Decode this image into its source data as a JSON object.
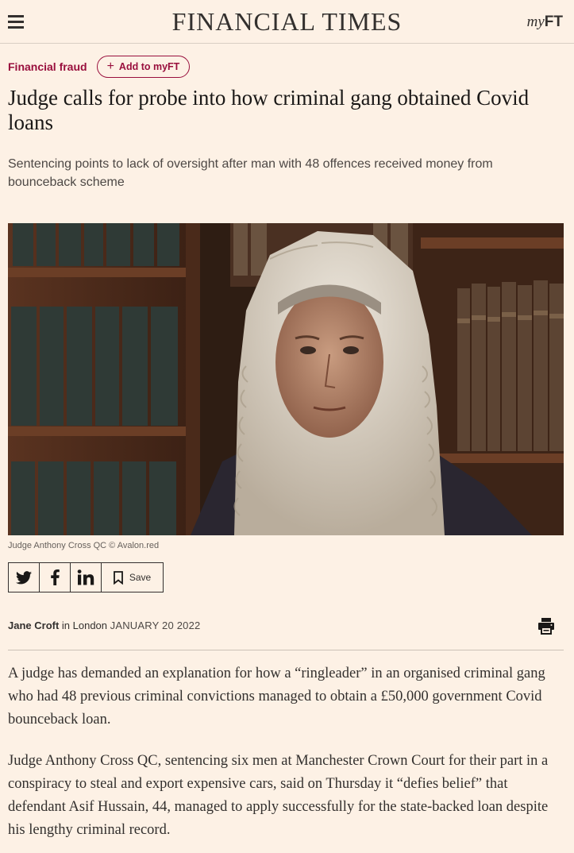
{
  "header": {
    "masthead": "FINANCIAL TIMES",
    "myft_prefix": "my",
    "myft_suffix": "FT",
    "menu_icon": "hamburger-menu-icon"
  },
  "article": {
    "topic": "Financial fraud",
    "add_to_myft": "Add to myFT",
    "headline": "Judge calls for probe into how criminal gang obtained Covid loans",
    "standfirst": "Sentencing points to lack of oversight after man with 48 offences received money from bounceback scheme",
    "image_caption": "Judge Anthony Cross QC © Avalon.red",
    "share": {
      "icons": [
        "twitter-icon",
        "facebook-icon",
        "linkedin-icon",
        "bookmark-icon"
      ],
      "save_label": "Save"
    },
    "byline": {
      "author": "Jane Croft",
      "location_prefix": " in London ",
      "date": "JANUARY 20 2022"
    },
    "print_icon": "printer-icon",
    "paragraphs": [
      "A judge has demanded an explanation for how a “ringleader” in an organised criminal gang who had 48 previous criminal convictions managed to obtain a £50,000 government Covid bounceback loan.",
      "Judge Anthony Cross QC, sentencing six men at Manchester Crown Court for their part in a conspiracy to steal and export expensive cars, said on Thursday it “defies belief” that defendant Asif Hussain, 44, managed to apply successfully for the state-backed loan despite his lengthy criminal record."
    ]
  },
  "colors": {
    "background": "#fdf1e5",
    "accent": "#990f3d",
    "text": "#33302e"
  }
}
